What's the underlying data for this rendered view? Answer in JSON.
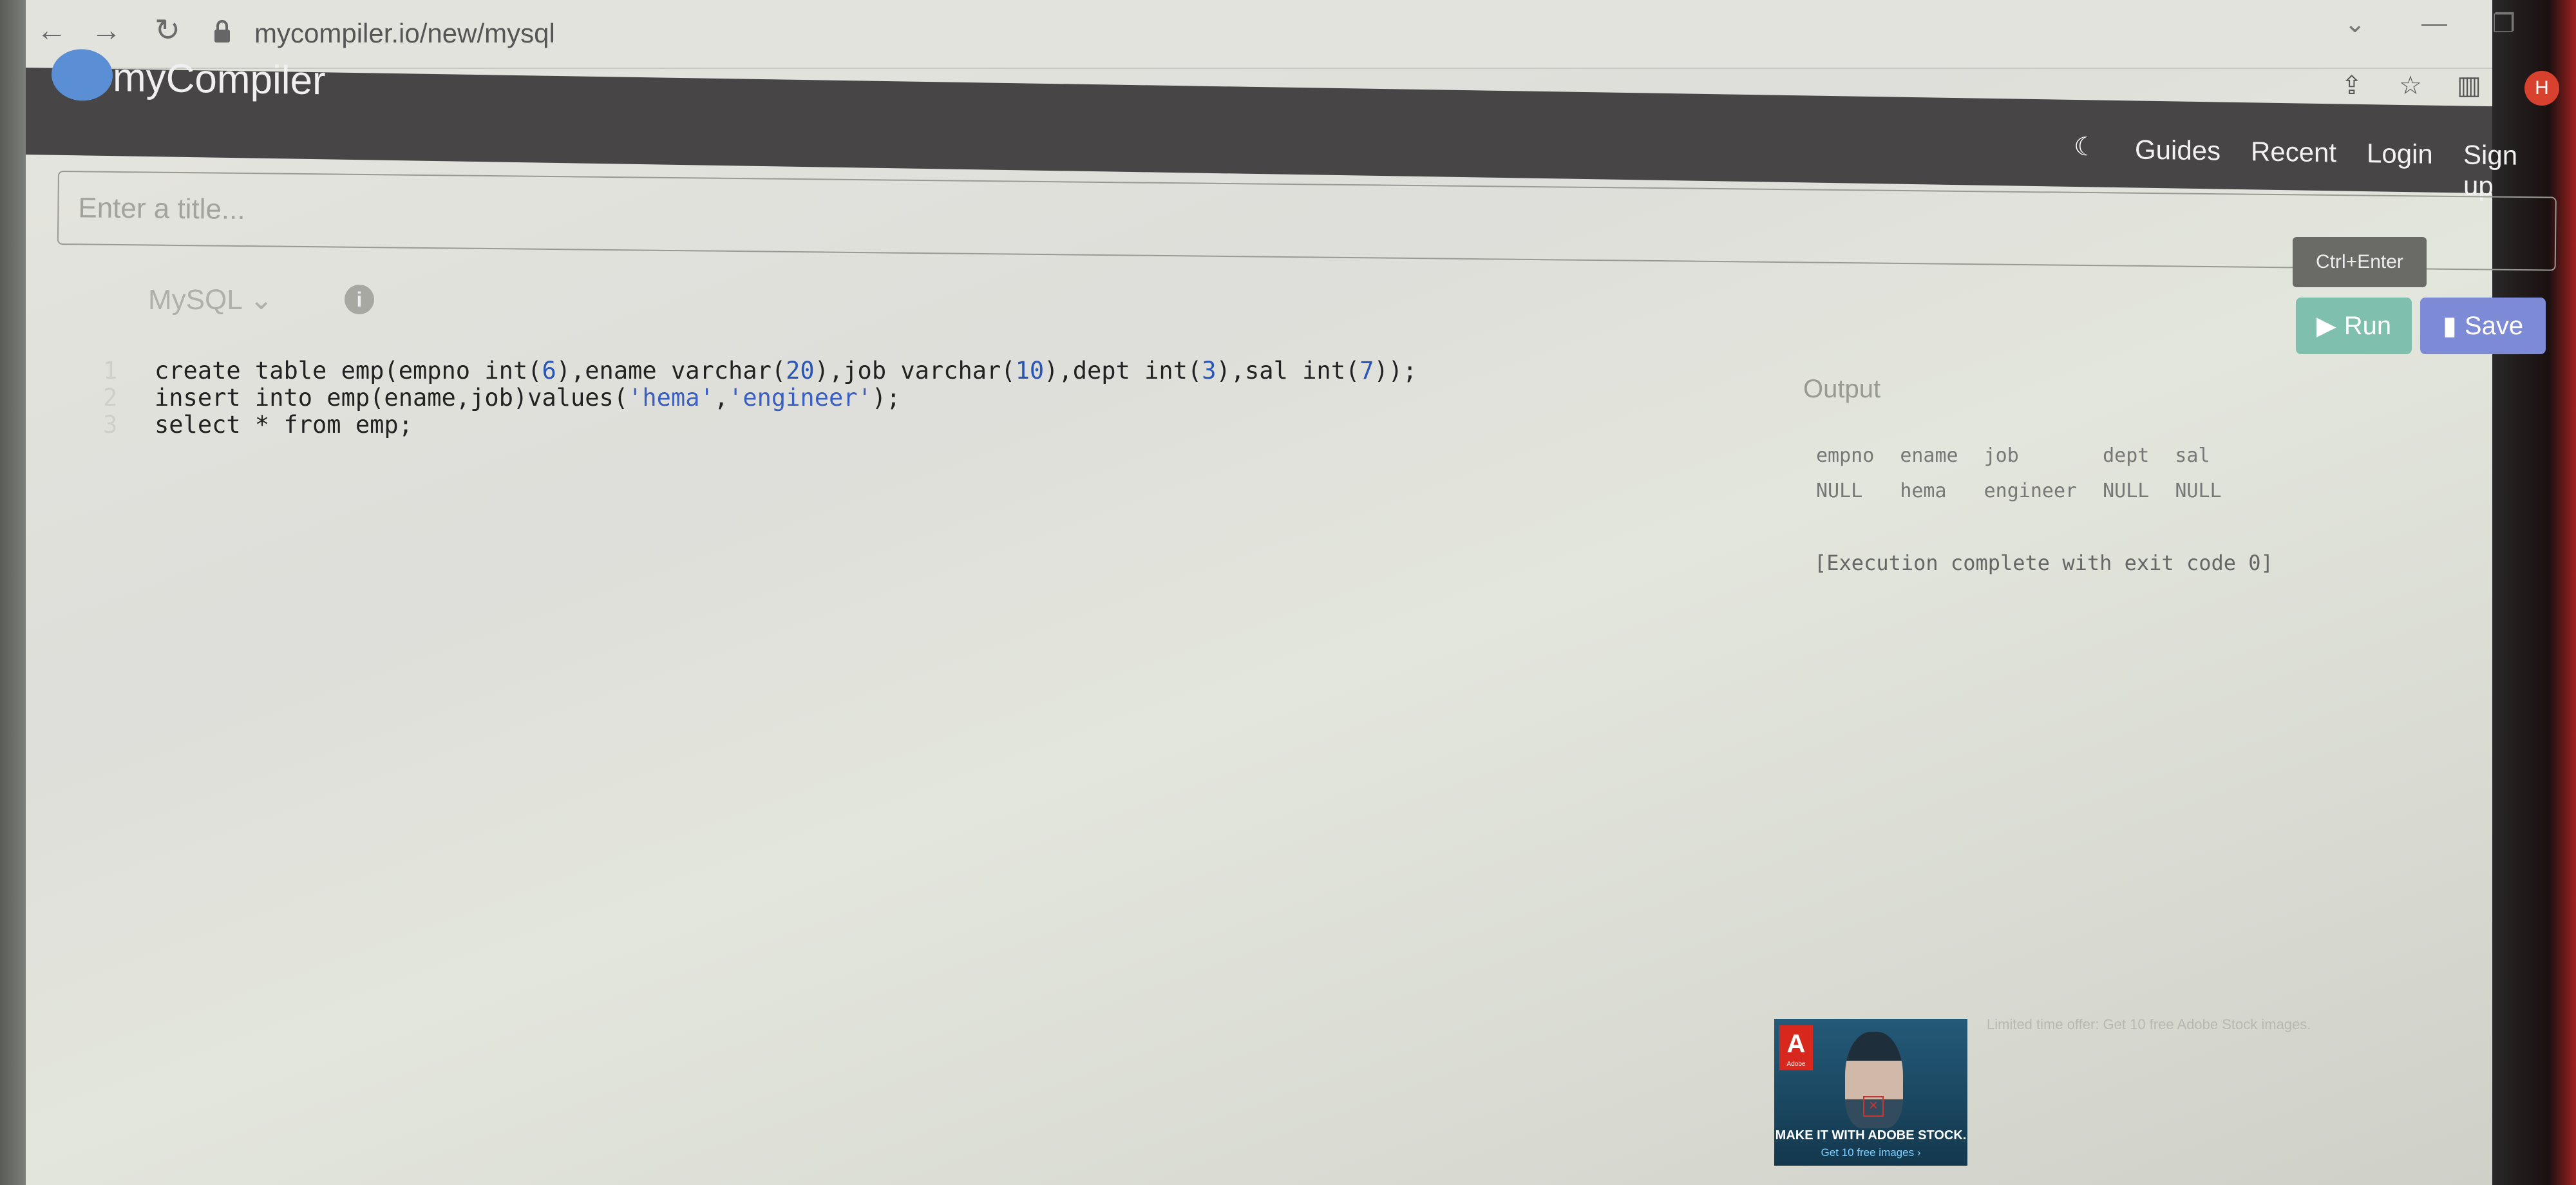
{
  "browser": {
    "url": "mycompiler.io/new/mysql",
    "back_icon": "←",
    "forward_icon": "→",
    "reload_icon": "↻"
  },
  "header": {
    "brand": "myCompiler",
    "links": [
      "Guides",
      "Recent",
      "Login",
      "Sign up"
    ],
    "avatar": "H"
  },
  "editor_title": {
    "placeholder": "Enter a title..."
  },
  "toolbar": {
    "language": "MySQL",
    "info_glyph": "i",
    "run_tooltip": "Ctrl+Enter",
    "run_label": "Run",
    "save_label": "Save"
  },
  "code": {
    "line_numbers": [
      "1",
      "2",
      "3"
    ],
    "lines": [
      "create table emp(empno int(6),ename varchar(20),job varchar(10),dept int(3),sal int(7));",
      "insert into emp(ename,job)values('hema','engineer');",
      "select * from emp;"
    ]
  },
  "output": {
    "title": "Output",
    "columns": [
      "empno",
      "ename",
      "job",
      "dept",
      "sal"
    ],
    "row": [
      "NULL",
      "hema",
      "engineer",
      "NULL",
      "NULL"
    ],
    "exec_message": "[Execution complete with exit code 0]"
  },
  "ad": {
    "logo": "A",
    "logo_sub": "Adobe",
    "headline": "MAKE IT WITH ADOBE STOCK.",
    "subline": "Get 10 free images ›",
    "side_text": "Limited time offer: Get 10 free Adobe Stock images."
  },
  "colors": {
    "header_bg": "#474545",
    "run_button": "#7fbfad",
    "save_button": "#7d8bd6",
    "number_literal": "#2a55b8"
  }
}
